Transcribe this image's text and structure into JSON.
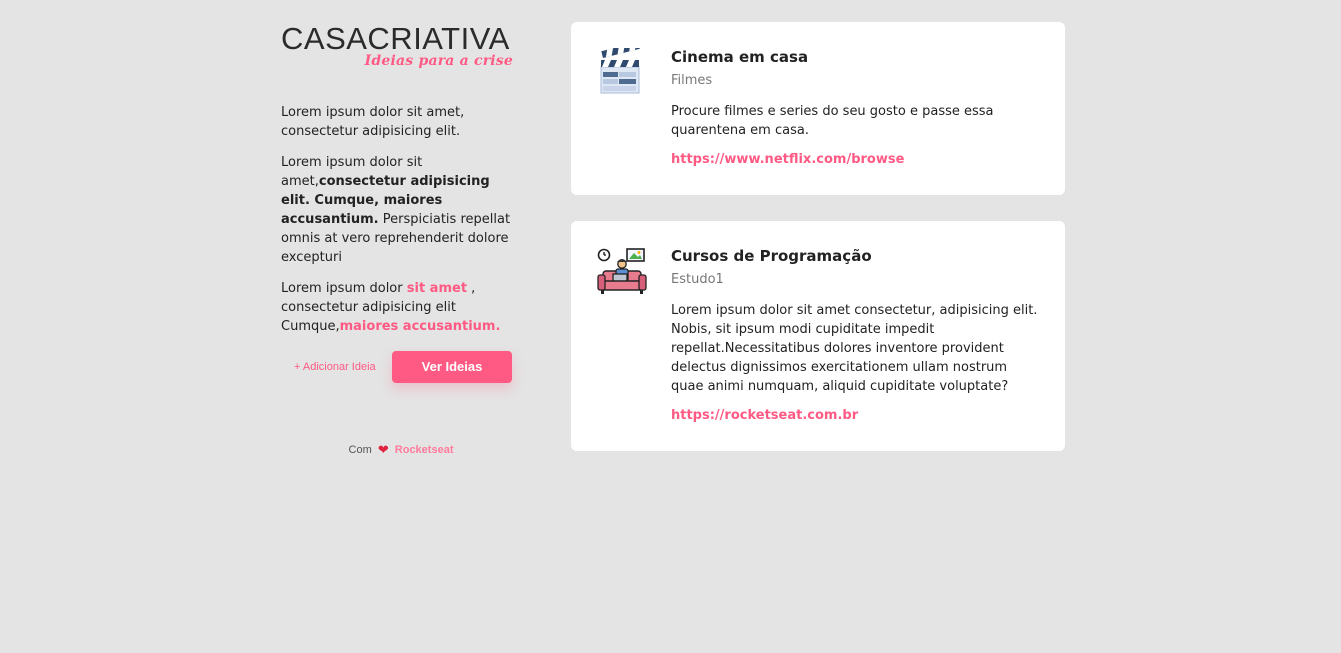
{
  "logo": {
    "main_left": "CASA",
    "main_right": "CRIATIVA",
    "tagline": "Ideias para a crise"
  },
  "intro": {
    "p1": "Lorem ipsum dolor sit amet, consectetur adipisicing elit.",
    "p2_a": "Lorem ipsum dolor sit amet,",
    "p2_b": "consectetur adipisicing elit. Cumque, maiores accusantium.",
    "p2_c": " Perspiciatis repellat omnis at vero reprehenderit dolore excepturi",
    "p3_a": "Lorem ipsum dolor ",
    "p3_b": "sit amet",
    "p3_c": " , consectetur adipisicing elit Cumque,",
    "p3_d": "maiores accusantium."
  },
  "actions": {
    "add_label": "+ Adicionar Ideia",
    "view_label": "Ver Ideias"
  },
  "footer": {
    "prefix": "Com",
    "heart": "❤",
    "brand": "Rocketseat"
  },
  "ideas": [
    {
      "icon": "clapperboard-icon",
      "title": "Cinema em casa",
      "category": "Filmes",
      "description": "Procure filmes e series do seu gosto e passe essa quarentena em casa.",
      "url": "https://www.netflix.com/browse"
    },
    {
      "icon": "person-coding-on-couch-icon",
      "title": "Cursos de Programação",
      "category": "Estudo1",
      "description": "Lorem ipsum dolor sit amet consectetur, adipisicing elit. Nobis, sit ipsum modi cupiditate impedit repellat.Necessitatibus dolores inventore provident delectus dignissimos exercitationem ullam nostrum quae animi numquam, aliquid cupiditate voluptate?",
      "url": "https://rocketseat.com.br"
    }
  ],
  "colors": {
    "background": "#e4e4e4",
    "accent": "#ff5a84",
    "card": "#ffffff",
    "text": "#222222"
  }
}
